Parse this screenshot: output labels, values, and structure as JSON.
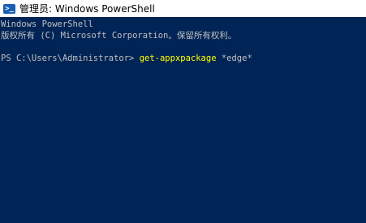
{
  "window": {
    "title": "管理员: Windows PowerShell",
    "icon": "powershell-icon",
    "icon_glyph": ">_"
  },
  "console": {
    "header_line1": "Windows PowerShell",
    "header_line2": "版权所有 (C) Microsoft Corporation。保留所有权利。",
    "prompt": "PS C:\\Users\\Administrator> ",
    "command": "get-appxpackage",
    "argument": " *edge*"
  },
  "colors": {
    "background": "#012456",
    "text": "#c0c0c0",
    "command": "#ffff00"
  }
}
